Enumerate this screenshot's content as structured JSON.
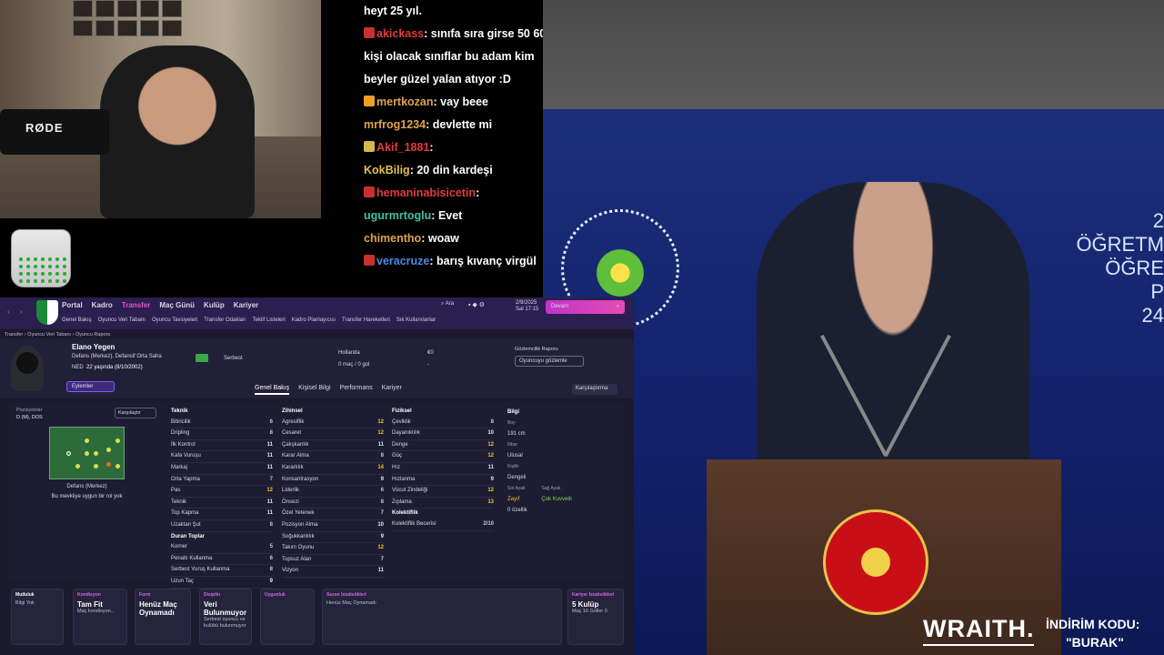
{
  "webcam": {
    "mic_brand": "RØDE"
  },
  "chat": {
    "messages": [
      {
        "user": "",
        "text": "heyt 25 yıl.",
        "color": "#ffffff",
        "badge": ""
      },
      {
        "user": "akickass",
        "text": "sınıfa sıra girse 50 60",
        "color": "#e33b3b",
        "badge": "#c9302c"
      },
      {
        "user": "",
        "text": "kişi olacak sınıflar bu adam kim",
        "color": "#ffffff",
        "badge": ""
      },
      {
        "user": "",
        "text": "beyler güzel yalan atıyor :D",
        "color": "#ffffff",
        "badge": ""
      },
      {
        "user": "mertkozan",
        "text": "vay beee",
        "color": "#e0a44a",
        "badge": "#f0a020"
      },
      {
        "user": "mrfrog1234",
        "text": "devlette mi",
        "color": "#e0a44a",
        "badge": ""
      },
      {
        "user": "Akif_1881",
        "text": "",
        "color": "#e33b3b",
        "badge": "#d4b84a"
      },
      {
        "user": "KokBilig",
        "text": "20 din kardeşi",
        "color": "#e0c050",
        "badge": ""
      },
      {
        "user": "hemaninabisicetin",
        "text": "",
        "color": "#e33b3b",
        "badge": "#c9302c"
      },
      {
        "user": "ugurmrtoglu",
        "text": "Evet",
        "color": "#45c0a0",
        "badge": ""
      },
      {
        "user": "chimentho",
        "text": "woaw",
        "color": "#e0a44a",
        "badge": ""
      },
      {
        "user": "veracruze",
        "text": "barış kıvanç virgül",
        "color": "#4a8be0",
        "badge": "#c9302c"
      }
    ]
  },
  "stage": {
    "sign_line1": "2",
    "sign_line2": "ÖĞRETM",
    "sign_line3": "ÖĞRE",
    "sign_line4": "P",
    "sign_line5": "24"
  },
  "promo": {
    "brand": "WRAITH.",
    "label": "İNDİRİM KODU:",
    "code": "\"BURAK\""
  },
  "fm": {
    "nav": [
      "Portal",
      "Kadro",
      "Transfer",
      "Maç Günü",
      "Kulüp",
      "Kariyer"
    ],
    "subnav": [
      "Genel Bakış",
      "Oyuncu Veri Tabanı",
      "Oyuncu Tavsiyeleri",
      "Transfer Odakları",
      "Teklif Listeleri",
      "Kadro Planlayıcısı",
      "Transfer Hareketleri",
      "Sık Kullanılanlar"
    ],
    "search": "Ara",
    "date_line1": "2/9/2025",
    "date_line2": "Sal 17:15",
    "continue": "Devam",
    "breadcrumb": "Transfer  ›  Oyuncu Veri Tabanı  ›  Oyuncu Raporu",
    "player": {
      "name": "Elano Yegen",
      "positions": "Defans (Merkez), Defansif Orta Saha",
      "nat": "NED",
      "age": "22 yaşında (8/10/2002)",
      "status": "Serbest",
      "country": "Hollanda",
      "caps": "0 maç / 0 gol",
      "value": "€0",
      "value2": "-"
    },
    "scout_title": "Gözlemcilik Raporu",
    "scout_btn": "Oyuncuyu gözlemle",
    "actions": "Eylemler",
    "tabs": [
      "Genel Bakış",
      "Kişisel Bilgi",
      "Performans",
      "Kariyer"
    ],
    "compare": "Karşılaştırma",
    "positions_label": "Pozisyonlar",
    "positions_value": "D (M), DOS",
    "compare_btn": "Karşılaştır",
    "pitch_label": "Defans (Merkez)",
    "pitch_sub": "Bu mevkiiye uygun bir rol yok",
    "technical_title": "Teknik",
    "technical": [
      [
        "Bitiricilik",
        "6"
      ],
      [
        "Dripling",
        "8"
      ],
      [
        "İlk Kontrol",
        "11"
      ],
      [
        "Kafa Vuruşu",
        "11"
      ],
      [
        "Markaj",
        "11"
      ],
      [
        "Orta Yapma",
        "7"
      ],
      [
        "Pas",
        "12"
      ],
      [
        "Teknik",
        "11"
      ],
      [
        "Top Kapma",
        "11"
      ],
      [
        "Uzaktan Şut",
        "8"
      ]
    ],
    "setpieces_title": "Duran Toplar",
    "setpieces": [
      [
        "Korner",
        "5"
      ],
      [
        "Penaltı Kullanma",
        "6"
      ],
      [
        "Serbest Vuruş Kullanma",
        "8"
      ],
      [
        "Uzun Taç",
        "9"
      ]
    ],
    "mental_title": "Zihinsel",
    "mental": [
      [
        "Agresiflik",
        "12"
      ],
      [
        "Cesaret",
        "12"
      ],
      [
        "Çalışkanlık",
        "11"
      ],
      [
        "Karar Alma",
        "8"
      ],
      [
        "Kararlılık",
        "14"
      ],
      [
        "Konsantrasyon",
        "9"
      ],
      [
        "Liderlik",
        "6"
      ],
      [
        "Önsezi",
        "8"
      ],
      [
        "Özel Yetenek",
        "7"
      ],
      [
        "Pozisyon Alma",
        "10"
      ],
      [
        "Soğukkanlılık",
        "9"
      ],
      [
        "Takım Oyunu",
        "12"
      ],
      [
        "Topsuz Alan",
        "7"
      ],
      [
        "Vizyon",
        "11"
      ]
    ],
    "physical_title": "Fiziksel",
    "physical": [
      [
        "Çeviklik",
        "8"
      ],
      [
        "Dayanıklılık",
        "10"
      ],
      [
        "Denge",
        "12"
      ],
      [
        "Güç",
        "12"
      ],
      [
        "Hız",
        "11"
      ],
      [
        "Hızlanma",
        "9"
      ],
      [
        "Vücut Zindeliği",
        "12"
      ],
      [
        "Zıplama",
        "13"
      ]
    ],
    "team_title": "Kolektiflik",
    "team": [
      [
        "Kolektiflik Becerisi",
        "2/10"
      ]
    ],
    "info_title": "Bilgi",
    "info": {
      "height_k": "Boy",
      "height": "191 cm",
      "rep_k": "İtibar",
      "rep": "Ulusal",
      "pers_k": "Kişilik",
      "pers": "Dengeli",
      "left_k": "Sol Ayak",
      "left": "Zayıf",
      "right_k": "Sağ Ayak",
      "right": "Çok Kuvvetli",
      "traits": "0 özellik"
    },
    "bottom": [
      {
        "title": "Mutluluk",
        "value": "",
        "sub": "Bilgi Yok"
      },
      {
        "title": "Kondisyon",
        "value": "Tam Fit",
        "sub": "Maç kondisyon..."
      },
      {
        "title": "Form",
        "value": "Henüz Maç Oynamadı",
        "sub": ""
      },
      {
        "title": "Disiplin",
        "value": "Veri Bulunmuyor",
        "sub": "Serbest oyuncu ve kulübü bulunmuyor"
      },
      {
        "title": "Uygunluk",
        "value": "",
        "sub": ""
      },
      {
        "title": "Sezon İstatistikleri",
        "value": "",
        "sub": "Henüz Maç Oynamadı"
      },
      {
        "title": "Kariyer İstatistikleri",
        "value": "5 Kulüp",
        "sub": "Maç 16  Goller 0"
      }
    ]
  }
}
